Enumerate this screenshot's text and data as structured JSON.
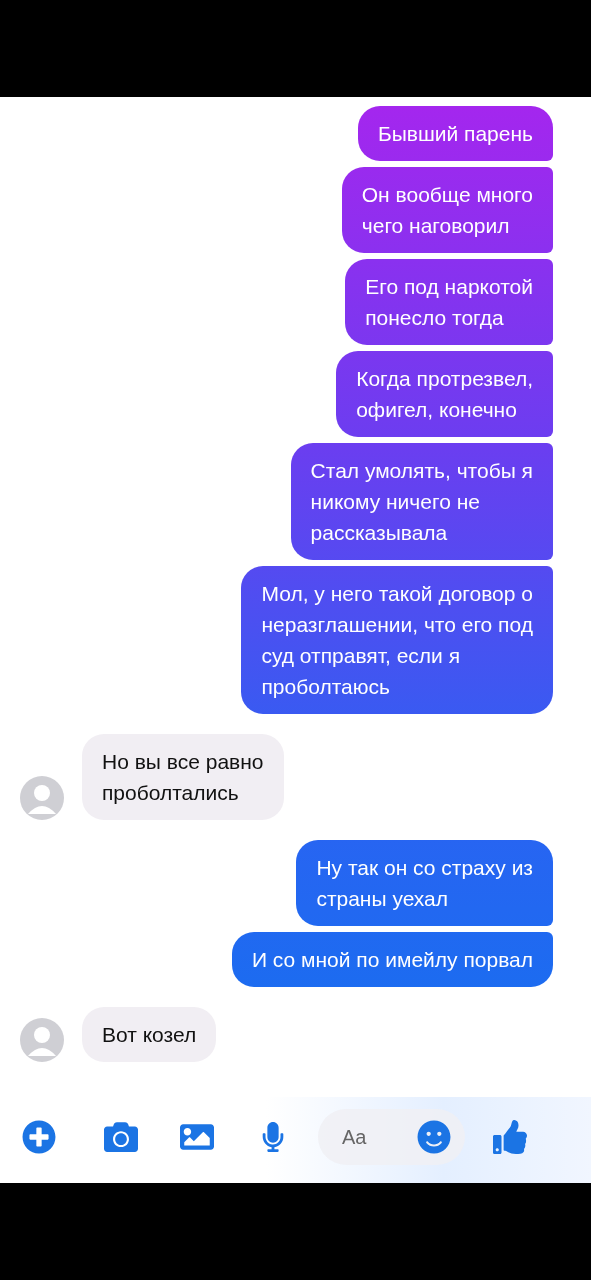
{
  "messages": [
    {
      "kind": "outgoing",
      "text": "Бывший парень"
    },
    {
      "kind": "outgoing",
      "text": "Он вообще много\nчего наговорил"
    },
    {
      "kind": "outgoing",
      "text": "Его под наркотой\nпонесло тогда"
    },
    {
      "kind": "outgoing",
      "text": "Когда протрезвел,\nофигел, конечно"
    },
    {
      "kind": "outgoing",
      "text": "Стал умолять, чтобы я\nникому ничего не\nрассказывала"
    },
    {
      "kind": "outgoing",
      "text": "Мол, у него такой договор о\nнеразглашении, что его под\nсуд отправят, если я\nпроболтаюсь"
    },
    {
      "kind": "incoming",
      "text": "Но вы все равно\nпроболтались"
    },
    {
      "kind": "outgoing",
      "text": "Ну так он со страху из\nстраны уехал"
    },
    {
      "kind": "outgoing",
      "text": "И со мной по имейлу порвал"
    },
    {
      "kind": "incoming",
      "text": "Вот козел"
    }
  ],
  "composer": {
    "placeholder": "Aa"
  }
}
